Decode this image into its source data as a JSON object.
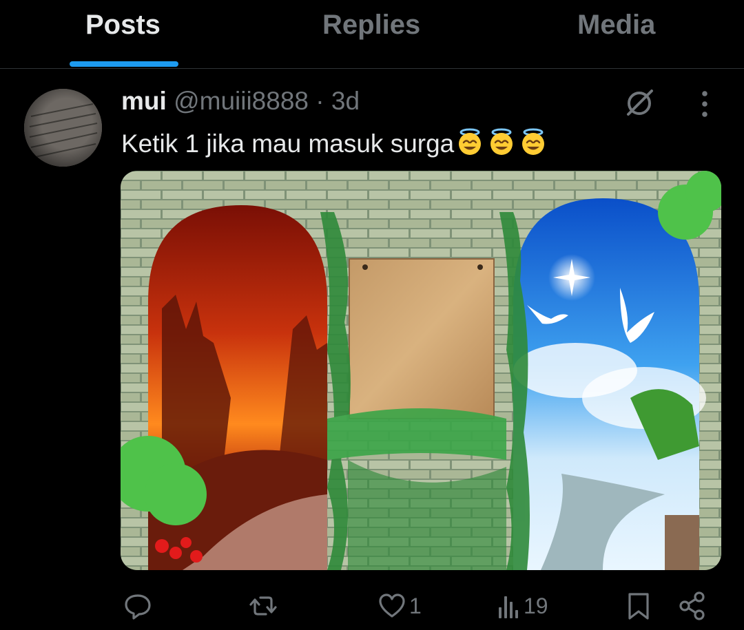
{
  "tabs": {
    "posts": "Posts",
    "replies": "Replies",
    "media": "Media"
  },
  "post": {
    "name": "mui",
    "handle": "@muiii8888",
    "separator": "·",
    "time": "3d",
    "text": "Ketik 1 jika mau masuk surga",
    "emojis": [
      "smiling-face-with-halo",
      "smiling-face-with-halo",
      "smiling-face-with-halo"
    ]
  },
  "actions": {
    "reply_count": "",
    "repost_count": "",
    "like_count": "1",
    "views_count": "19"
  },
  "colors": {
    "background": "#000000",
    "accent": "#1d9bf0",
    "text_primary": "#e7e9ea",
    "text_secondary": "#71767b"
  }
}
